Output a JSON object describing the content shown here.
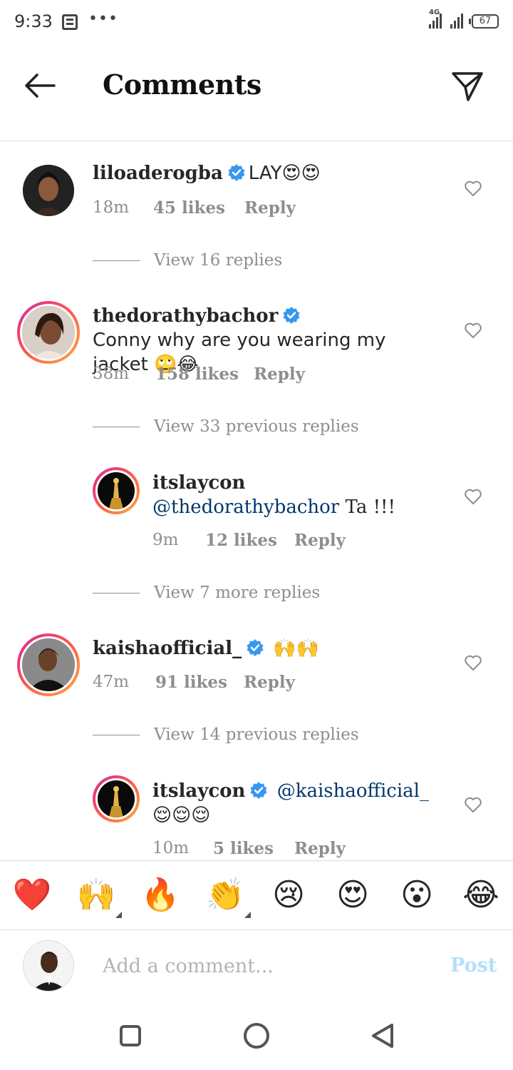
{
  "status_bar": {
    "time": "9:33",
    "dots": "•••",
    "network_label": "4G",
    "battery": "67"
  },
  "header": {
    "title": "Comments"
  },
  "comments": [
    {
      "username": "liloaderogba",
      "verified": true,
      "text": "LAY😍😍",
      "time": "18m",
      "likes": "45 likes",
      "reply": "Reply",
      "view_replies": "View 16 replies"
    },
    {
      "username": "thedorathybachor",
      "verified": true,
      "text": "Conny why are you wearing my jacket 🙄😂",
      "time": "38m",
      "likes": "158 likes",
      "reply": "Reply",
      "view_replies": "View 33 previous replies"
    },
    {
      "username": "itslaycon",
      "verified": false,
      "mention": "@thedorathybachor",
      "text": "Ta !!!",
      "time": "9m",
      "likes": "12 likes",
      "reply": "Reply",
      "view_replies": "View 7 more replies"
    },
    {
      "username": "kaishaofficial_",
      "verified": true,
      "text": "🙌🙌",
      "time": "47m",
      "likes": "91 likes",
      "reply": "Reply",
      "view_replies": "View 14 previous replies"
    },
    {
      "username": "itslaycon",
      "verified": true,
      "mention": "@kaishaofficial_",
      "text": "😌😌😌",
      "time": "10m",
      "likes": "5 likes",
      "reply": "Reply"
    }
  ],
  "emoji_bar": [
    "❤️",
    "🙌",
    "🔥",
    "👏",
    "😢",
    "😍",
    "😮",
    "😂"
  ],
  "composer": {
    "placeholder": "Add a comment...",
    "post_label": "Post"
  },
  "colors": {
    "link_blue": "#00376b",
    "verified_blue": "#3897f0",
    "muted_gray": "#8e8e8e",
    "post_disabled": "#b2dffc"
  }
}
